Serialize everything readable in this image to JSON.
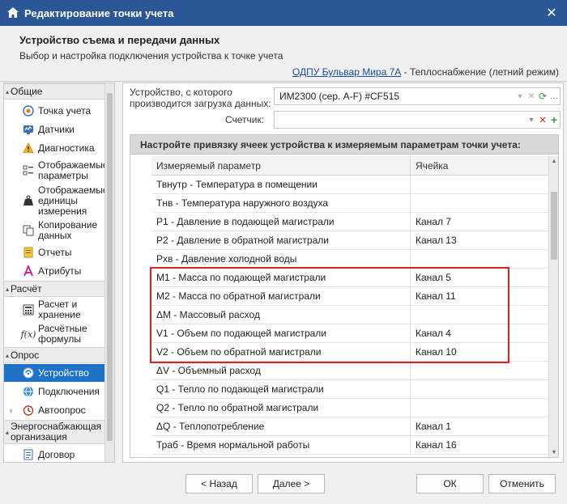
{
  "window": {
    "title": "Редактирование точки учета",
    "close_glyph": "✕"
  },
  "header": {
    "title": "Устройство съема и передачи данных",
    "subtitle": "Выбор и настройка подключения устройства к точке учета",
    "link": "ОДПУ Бульвар Мира 7А",
    "link_suffix": " - Теплоснабжение (летний режим)"
  },
  "sidebar": {
    "groups": [
      {
        "label": "Общие"
      },
      {
        "label": "Расчёт"
      },
      {
        "label": "Опрос"
      },
      {
        "label": "Энергоснабжающая организация"
      }
    ],
    "items": [
      {
        "label": "Точка учета",
        "icon": "meter-point-icon"
      },
      {
        "label": "Датчики",
        "icon": "sensors-icon"
      },
      {
        "label": "Диагностика",
        "icon": "warning-icon"
      },
      {
        "label": "Отображаемые параметры",
        "icon": "params-list-icon"
      },
      {
        "label": "Отображаемые единицы измерения",
        "icon": "weight-icon"
      },
      {
        "label": "Копирование данных",
        "icon": "copy-icon"
      },
      {
        "label": "Отчеты",
        "icon": "report-icon"
      },
      {
        "label": "Атрибуты",
        "icon": "attributes-icon"
      },
      {
        "label": "Расчет и хранение",
        "icon": "calc-icon"
      },
      {
        "label": "Расчётные формулы",
        "icon": "formula-icon"
      },
      {
        "label": "Устройство",
        "icon": "device-icon"
      },
      {
        "label": "Подключения",
        "icon": "connections-icon"
      },
      {
        "label": "Автоопрос",
        "icon": "auto-poll-icon"
      },
      {
        "label": "Договор",
        "icon": "contract-icon"
      }
    ]
  },
  "device": {
    "label": "Устройство, с которого производится загрузка данных:",
    "value": "ИМ2300 (сер. А-F) #CF515"
  },
  "counter": {
    "label": "Счетчик:",
    "value": ""
  },
  "grid": {
    "title": "Настройте привязку ячеек устройства к измеряемым параметрам точки учета:",
    "col_param": "Измеряемый параметр",
    "col_cell": "Ячейка",
    "rows": [
      {
        "param": "Твнутр - Температура в помещении",
        "cell": ""
      },
      {
        "param": "Тнв - Температура наружного воздуха",
        "cell": ""
      },
      {
        "param": "P1 - Давление в подающей магистрали",
        "cell": "Канал 7"
      },
      {
        "param": "P2 - Давление в обратной магистрали",
        "cell": "Канал 13"
      },
      {
        "param": "Pхв - Давление холодной воды",
        "cell": ""
      },
      {
        "param": "M1 - Масса по подающей магистрали",
        "cell": "Канал 5"
      },
      {
        "param": "M2 - Масса по обратной магистрали",
        "cell": "Канал 11"
      },
      {
        "param": "ΔM - Массовый расход",
        "cell": ""
      },
      {
        "param": "V1 - Объем по подающей магистрали",
        "cell": "Канал 4"
      },
      {
        "param": "V2 - Объем по обратной магистрали",
        "cell": "Канал 10"
      },
      {
        "param": "ΔV - Объемный расход",
        "cell": ""
      },
      {
        "param": "Q1 - Тепло по подающей магистрали",
        "cell": ""
      },
      {
        "param": "Q2 - Тепло по обратной магистрали",
        "cell": ""
      },
      {
        "param": "ΔQ - Теплопотребление",
        "cell": "Канал 1"
      },
      {
        "param": "Траб - Время нормальной работы",
        "cell": "Канал 16"
      }
    ]
  },
  "footer": {
    "back": "< Назад",
    "next": "Далее >",
    "ok": "ОК",
    "cancel": "Отменить"
  }
}
